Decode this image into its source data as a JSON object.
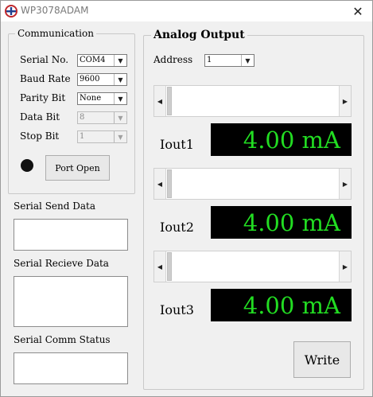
{
  "window": {
    "title": "WP3078ADAM",
    "close_glyph": "✕",
    "app_icon": "app-logo-icon"
  },
  "communication": {
    "title": "Communication",
    "serial_no": {
      "label": "Serial No.",
      "value": "COM4"
    },
    "baud_rate": {
      "label": "Baud Rate",
      "value": "9600"
    },
    "parity_bit": {
      "label": "Parity Bit",
      "value": "None"
    },
    "data_bit": {
      "label": "Data Bit",
      "value": "8"
    },
    "stop_bit": {
      "label": "Stop Bit",
      "value": "1"
    },
    "port_open_label": "Port Open",
    "status_led_color": "#111111",
    "send_data_label": "Serial Send Data",
    "send_data_value": "",
    "recieve_data_label": "Serial Recieve Data",
    "recieve_data_value": "",
    "comm_status_label": "Serial Comm Status",
    "comm_status_value": ""
  },
  "analog_output": {
    "title": "Analog Output",
    "address": {
      "label": "Address",
      "value": "1"
    },
    "outputs": [
      {
        "label": "Iout1",
        "display": "4.00 mA"
      },
      {
        "label": "Iout2",
        "display": "4.00 mA"
      },
      {
        "label": "Iout3",
        "display": "4.00 mA"
      }
    ],
    "write_label": "Write",
    "display_color": "#22dd22"
  }
}
